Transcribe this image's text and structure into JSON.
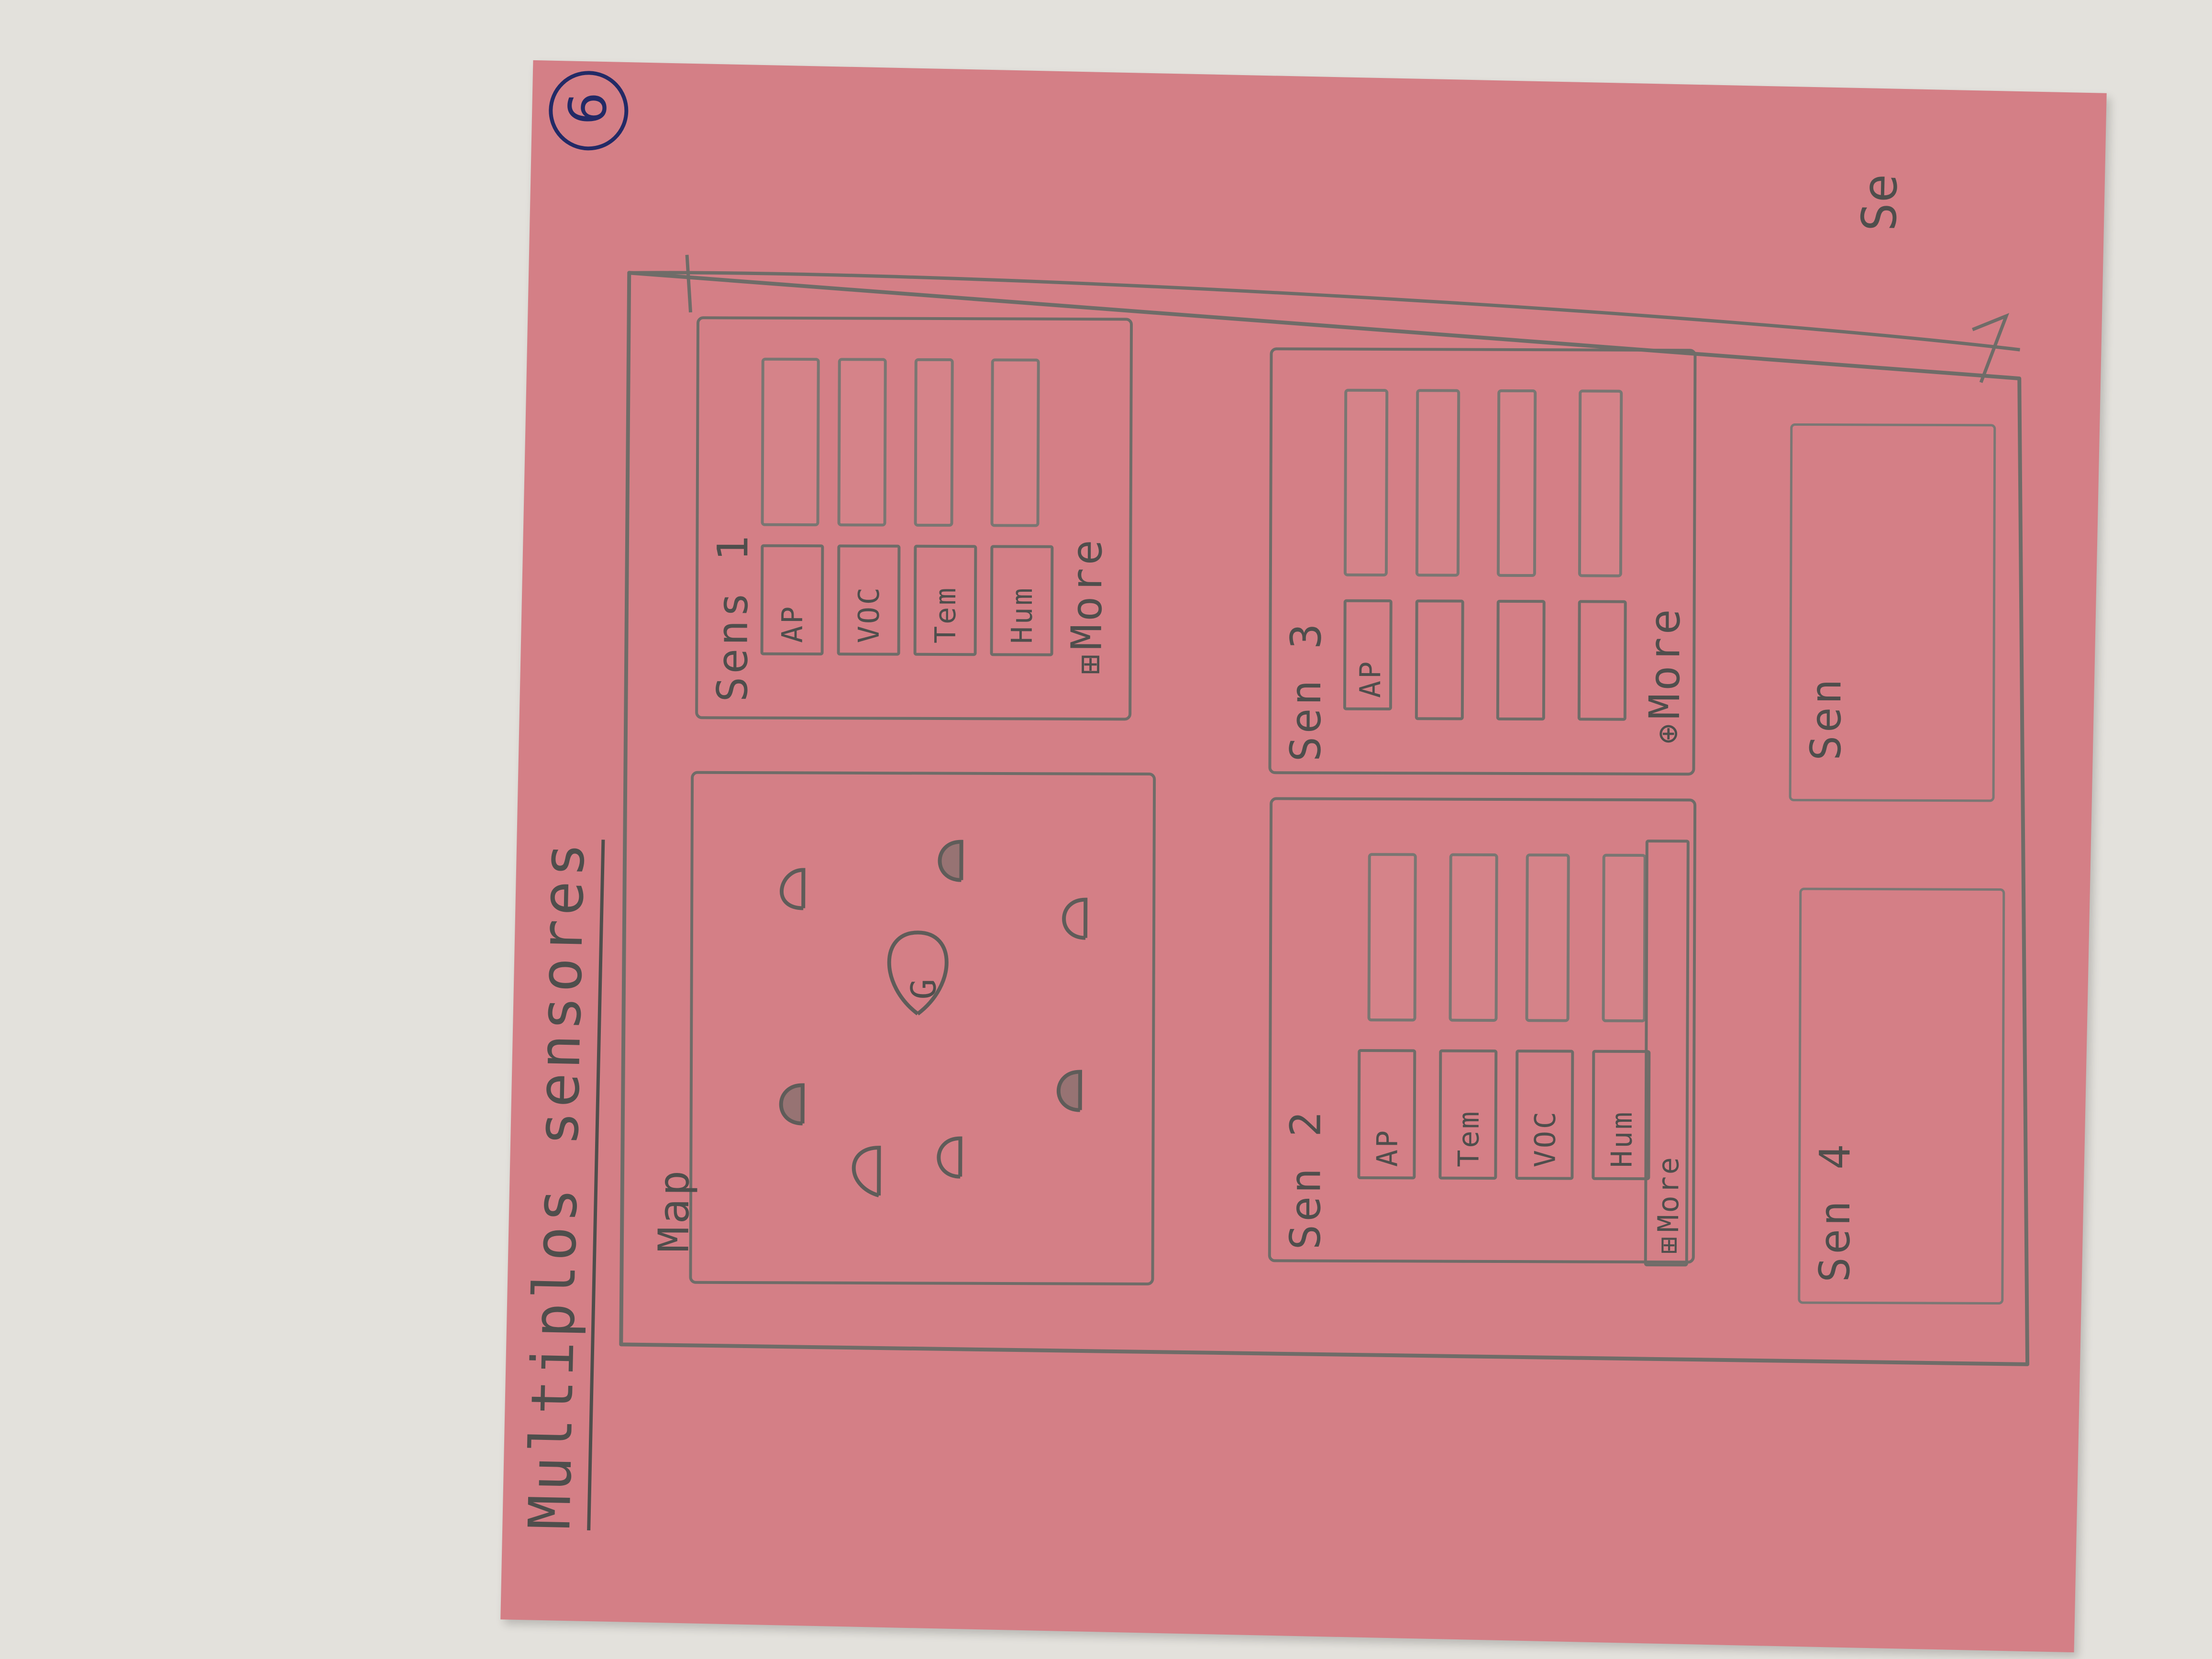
{
  "page_number": "6",
  "title": "Multiplos sensores",
  "corner_mark": "Se",
  "map": {
    "label": "Map",
    "center_pin_label": "G"
  },
  "cards": [
    {
      "id": "sensor-1",
      "title": "Sens 1",
      "metrics": [
        "AP",
        "VOC",
        "Tem",
        "Hum"
      ],
      "more_label": "More"
    },
    {
      "id": "sensor-3",
      "title": "Sen 3",
      "metrics": [
        "AP"
      ],
      "more_label": "More"
    },
    {
      "id": "sensor-2",
      "title": "Sen 2",
      "metrics": [
        "AP",
        "Tem",
        "VOC",
        "Hum"
      ],
      "more_label": "More"
    },
    {
      "id": "sensor-4",
      "title": "Sen 4"
    },
    {
      "id": "sensor-5",
      "title": "Sen"
    }
  ]
}
